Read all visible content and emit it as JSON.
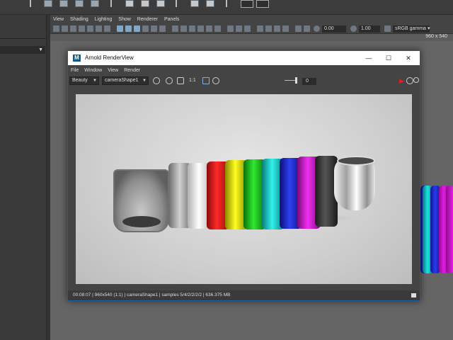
{
  "viewport": {
    "menu": [
      "View",
      "Shading",
      "Lighting",
      "Show",
      "Renderer",
      "Panels"
    ],
    "frame_field": "0.00",
    "gamma_field": "1.00",
    "color_space": "sRGB gamma",
    "resolution_label": "960 x 540"
  },
  "render_view": {
    "title": "Arnold RenderView",
    "logo": "M",
    "menu": [
      "File",
      "Window",
      "View",
      "Render"
    ],
    "aov_select": "Beauty",
    "camera_select": "cameraShape1",
    "ratio_label": "1:1",
    "exposure_value": "0",
    "status": "00:08:07 | 960x540 (1:1) | cameraShape1 | samples 5/4/2/2/2/2 | 636.375 MB",
    "window_buttons": {
      "minimize": "—",
      "maximize": "☐",
      "close": "✕"
    }
  },
  "render": {
    "ring_colors": [
      "#a8a8a8",
      "#e8e8e8",
      "#e0171c",
      "#e8e400",
      "#19c21e",
      "#18d6d2",
      "#1c22d4",
      "#d81bd6",
      "#2a2a2a"
    ],
    "cup_left": "glass",
    "cup_right": "chrome"
  },
  "viewport_scene": {
    "ring_colors": [
      "#1a2ad0",
      "#1ad0d0",
      "#1a2ad0",
      "#d01ad0",
      "#d01ad0"
    ]
  },
  "colors": {
    "accent": "#1e5c9e",
    "render_red_button": "#e02020"
  },
  "icons": [
    "arnold-logo-icon",
    "render-icon",
    "stop-icon",
    "refresh-icon",
    "snapshot-icon"
  ]
}
